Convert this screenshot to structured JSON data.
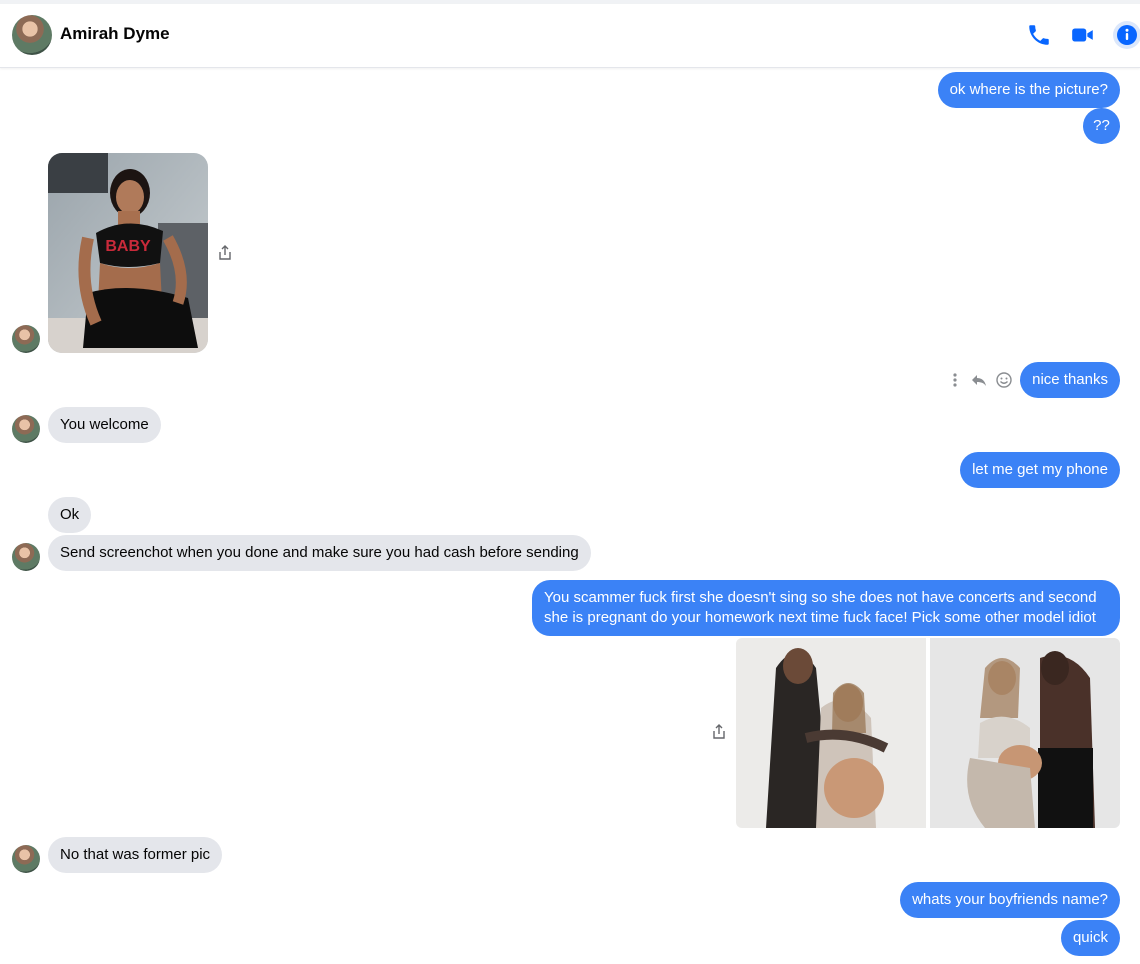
{
  "header": {
    "contact_name": "Amirah Dyme",
    "icons": [
      "phone-icon",
      "video-call-icon",
      "info-icon"
    ],
    "accent_color": "#0866ff"
  },
  "messages": [
    {
      "dir": "out",
      "text": "ok where is the picture?"
    },
    {
      "dir": "out",
      "text": "??"
    },
    {
      "dir": "in",
      "type": "image",
      "alt": "Photo of a woman in a black crop top with red lettering",
      "shirt_text": "BABY"
    },
    {
      "dir": "out",
      "text": "nice thanks"
    },
    {
      "dir": "in",
      "text": "You welcome"
    },
    {
      "dir": "out",
      "text": "let me get my phone"
    },
    {
      "dir": "in",
      "text": "Ok"
    },
    {
      "dir": "in",
      "text": "Send screenchot when you done and make sure you had cash before  sending"
    },
    {
      "dir": "out",
      "text": "You scammer fuck first she doesn't sing so she does not have concerts and second she is pregnant do your homework next time fuck face! Pick some other model idiot"
    },
    {
      "dir": "out",
      "type": "images",
      "count": 2
    },
    {
      "dir": "in",
      "text": "No that was former pic"
    },
    {
      "dir": "out",
      "text": "whats your boyfriends name?"
    },
    {
      "dir": "out",
      "text": "quick"
    }
  ],
  "colors": {
    "outgoing_bubble": "#3b82f6",
    "incoming_bubble": "#e4e6eb"
  }
}
